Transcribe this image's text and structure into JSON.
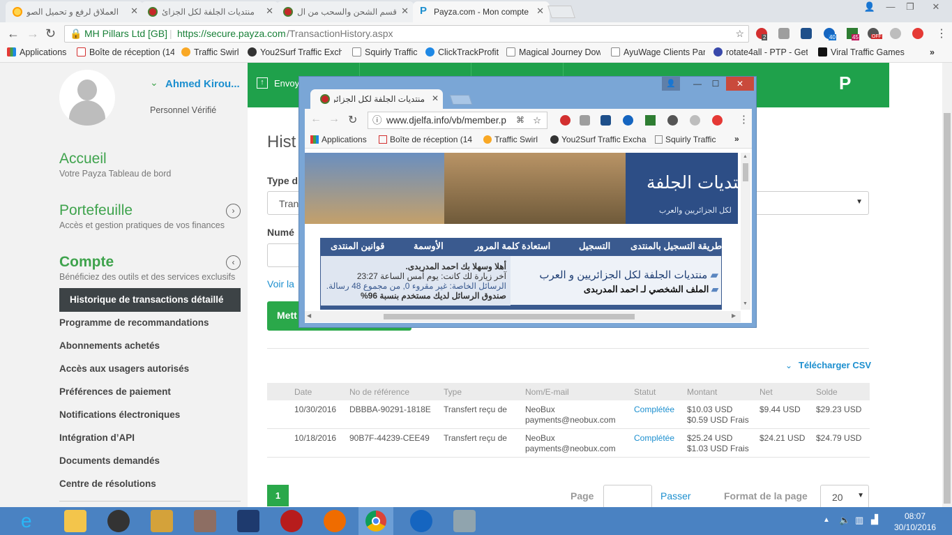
{
  "tabs": [
    {
      "title": "العملاق لرفع و تحميل الصو"
    },
    {
      "title": "منتديات الجلفة لكل الجزائ"
    },
    {
      "title": "قسم الشحن والسحب من ال"
    },
    {
      "title": "Payza.com - Mon compte"
    }
  ],
  "omnibox": {
    "secure_label": "MH Pillars Ltd [GB]",
    "url_host": "https://secure.payza.com",
    "url_path": "/TransactionHistory.aspx"
  },
  "bookmarks": [
    "Applications",
    "Boîte de réception (14",
    "Traffic Swirl",
    "You2Surf Traffic Excha",
    "Squirly Traffic",
    "ClickTrackProfit",
    "Magical Journey Dow",
    "AyuWage Clients Pane",
    "rotate4all - PTP - Get",
    "Viral Traffic Games"
  ],
  "extensions": {
    "abp_badge": "2",
    "badge40": "40",
    "badge45": "45",
    "off": "OFF"
  },
  "user": {
    "name": "Ahmed Kirou...",
    "status": "Personnel Vérifié"
  },
  "sidebar": {
    "accueil": {
      "title": "Accueil",
      "sub": "Votre Payza Tableau de bord"
    },
    "portefeuille": {
      "title": "Portefeuille",
      "sub": "Accès et gestion pratiques de vos finances"
    },
    "compte": {
      "title": "Compte",
      "sub": "Bénéficiez des outils et des services exclusifs"
    },
    "active": "Historique de transactions détaillé",
    "items": [
      "Programme de recommandations",
      "Abonnements achetés",
      "Accès aux usagers autorisés",
      "Préférences de paiement",
      "Notifications électroniques",
      "Intégration d’API",
      "Documents demandés",
      "Centre de résolutions"
    ]
  },
  "topbar": {
    "send": "Envoy"
  },
  "main": {
    "title_partial": "Hist",
    "type_label": "Type d",
    "type_value": "Tran",
    "num_label": "Numé",
    "view_link": "Voir la",
    "btn": "Mett",
    "download": "Télécharger CSV"
  },
  "table": {
    "headers": [
      "Date",
      "No de référence",
      "Type",
      "Nom/E-mail",
      "Statut",
      "Montant",
      "Net",
      "Solde"
    ],
    "rows": [
      {
        "date": "10/30/2016",
        "ref": "DBBBA-90291-1818E",
        "type": "Transfert reçu de",
        "name": "NeoBux",
        "email": "payments@neobux.com",
        "status": "Complétée",
        "amount": "$10.03 USD",
        "fee": "$0.59 USD Frais",
        "net": "$9.44 USD",
        "balance": "$29.23 USD"
      },
      {
        "date": "10/18/2016",
        "ref": "90B7F-44239-CEE49",
        "type": "Transfert reçu de",
        "name": "NeoBux",
        "email": "payments@neobux.com",
        "status": "Complétée",
        "amount": "$25.24 USD",
        "fee": "$1.03 USD Frais",
        "net": "$24.21 USD",
        "balance": "$24.79 USD"
      }
    ]
  },
  "pagination": {
    "current": "1",
    "page_label": "Page",
    "go": "Passer",
    "format_label": "Format de la page",
    "format_value": "20"
  },
  "popup": {
    "tab_title": "منتديات الجلفة لكل الجزائر",
    "url": "www.djelfa.info/vb/member.p",
    "bookmarks": [
      "Applications",
      "Boîte de réception (14",
      "Traffic Swirl",
      "You2Surf Traffic Excha",
      "Squirly Traffic"
    ],
    "nav": [
      "طريقة التسجيل بالمنتدى",
      "التسجيل",
      "استعادة كلمة المرور",
      "الأوسمة",
      "قوانين المنتدى"
    ],
    "forum_title": "منتديات الجلفة لكل الجزائريين و العرب",
    "profile": "الملف الشخصي لـ احمد المدربدى",
    "welcome": "أهلا وسهلا بك احمد المدربدى.",
    "last_visit": "آخر زيارة لك كانت: يوم أمس الساعة 23:27",
    "pm": "الرسائل الخاصة: غير مقروء 0, من مجموع 48 رسالة.",
    "box": "صندوق الرسائل لديك مستخدم بنسبة 96%",
    "logo": "منتديات الجلفة",
    "logo_sub": "لكل الجزائريين والعرب"
  },
  "clock": {
    "time": "08:07",
    "date": "30/10/2016"
  }
}
